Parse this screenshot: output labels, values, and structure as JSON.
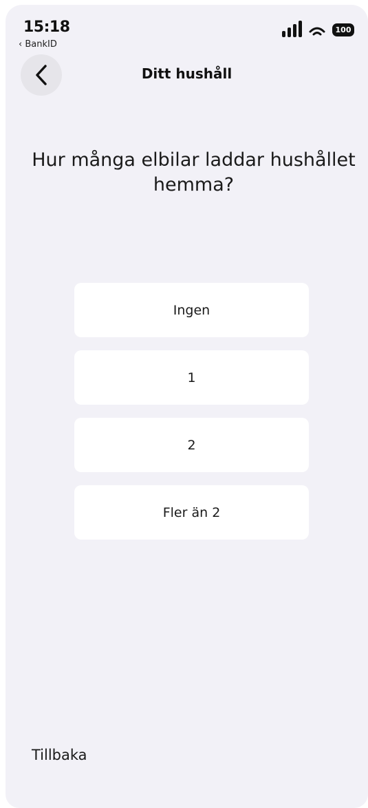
{
  "status_bar": {
    "time": "15:18",
    "back_app": "‹ BankID",
    "battery": "100"
  },
  "nav": {
    "title": "Ditt hushåll"
  },
  "question": "Hur många elbilar laddar hushållet hemma?",
  "options": [
    {
      "label": "Ingen"
    },
    {
      "label": "1"
    },
    {
      "label": "2"
    },
    {
      "label": "Fler än 2"
    }
  ],
  "footer": {
    "back_label": "Tillbaka"
  },
  "icons": {
    "back": "chevron-left-icon",
    "signal": "cellular-signal-icon",
    "wifi": "wifi-icon",
    "battery": "battery-icon"
  }
}
